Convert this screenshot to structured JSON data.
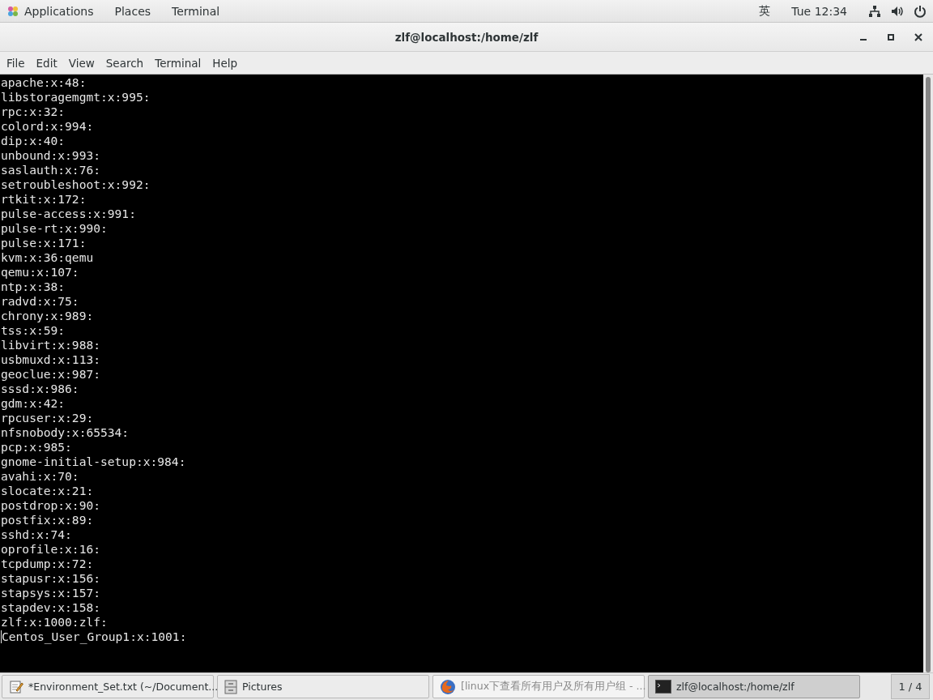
{
  "top_bar": {
    "menus": [
      "Applications",
      "Places",
      "Terminal"
    ],
    "input_method": "英",
    "clock": "Tue 12:34"
  },
  "window": {
    "title": "zlf@localhost:/home/zlf"
  },
  "menu_bar": [
    "File",
    "Edit",
    "View",
    "Search",
    "Terminal",
    "Help"
  ],
  "terminal": {
    "lines": [
      "apache:x:48:",
      "libstoragemgmt:x:995:",
      "rpc:x:32:",
      "colord:x:994:",
      "dip:x:40:",
      "unbound:x:993:",
      "saslauth:x:76:",
      "setroubleshoot:x:992:",
      "rtkit:x:172:",
      "pulse-access:x:991:",
      "pulse-rt:x:990:",
      "pulse:x:171:",
      "kvm:x:36:qemu",
      "qemu:x:107:",
      "ntp:x:38:",
      "radvd:x:75:",
      "chrony:x:989:",
      "tss:x:59:",
      "libvirt:x:988:",
      "usbmuxd:x:113:",
      "geoclue:x:987:",
      "sssd:x:986:",
      "gdm:x:42:",
      "rpcuser:x:29:",
      "nfsnobody:x:65534:",
      "pcp:x:985:",
      "gnome-initial-setup:x:984:",
      "avahi:x:70:",
      "slocate:x:21:",
      "postdrop:x:90:",
      "postfix:x:89:",
      "sshd:x:74:",
      "oprofile:x:16:",
      "tcpdump:x:72:",
      "stapusr:x:156:",
      "stapsys:x:157:",
      "stapdev:x:158:",
      "zlf:x:1000:zlf:",
      "Centos_User_Group1:x:1001:"
    ]
  },
  "taskbar": {
    "items": [
      {
        "kind": "editor",
        "label": "*Environment_Set.txt (~/Document...",
        "selected": false,
        "minimized": false
      },
      {
        "kind": "files",
        "label": "Pictures",
        "selected": false,
        "minimized": false
      },
      {
        "kind": "browser",
        "label": "[linux下查看所有用户及所有用户组 - ...",
        "selected": false,
        "minimized": true
      },
      {
        "kind": "terminal",
        "label": "zlf@localhost:/home/zlf",
        "selected": true,
        "minimized": false
      }
    ],
    "workspace": "1 / 4"
  }
}
